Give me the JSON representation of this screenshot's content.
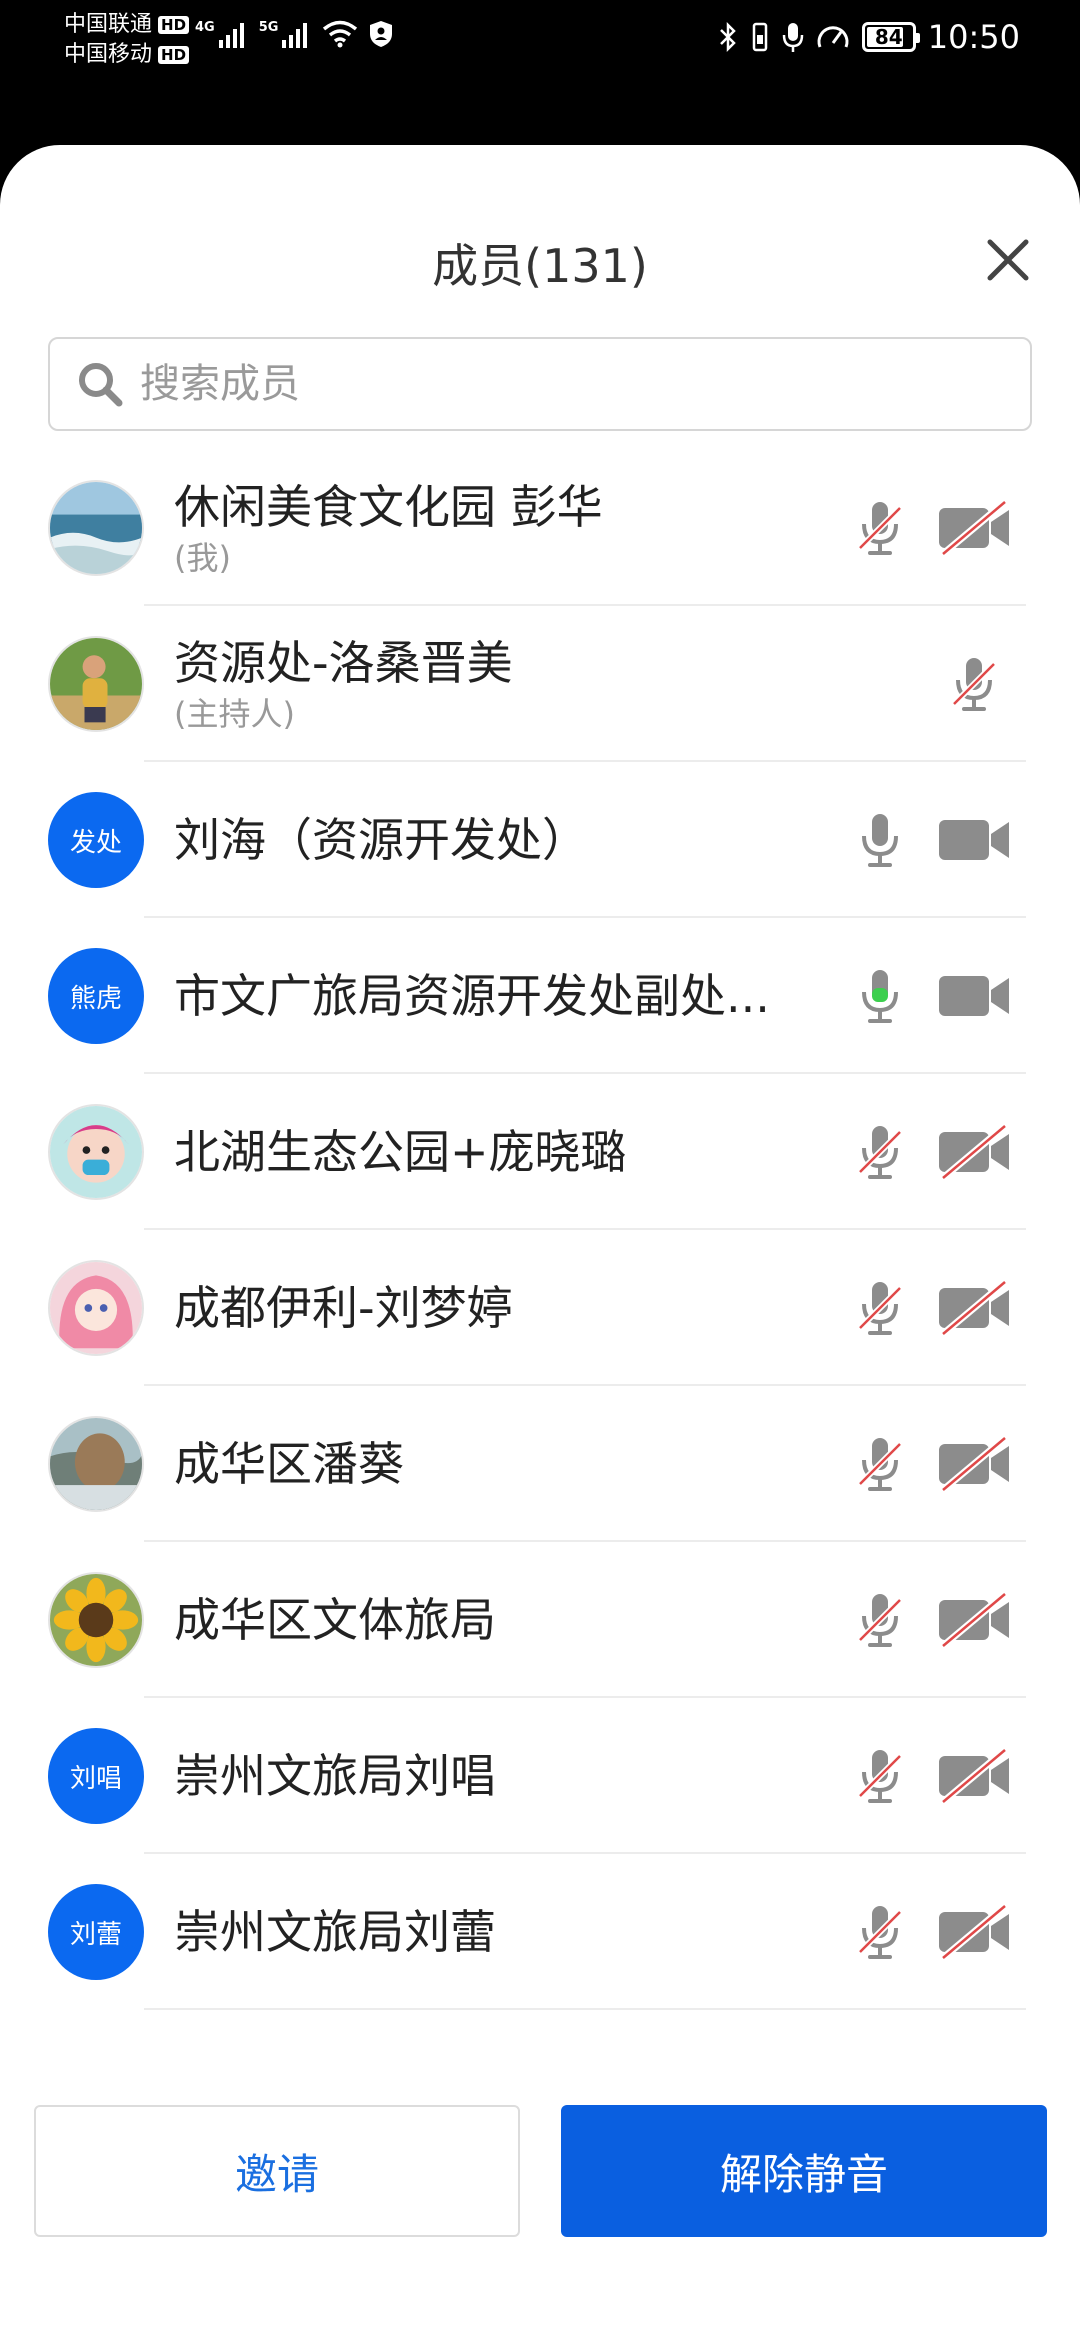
{
  "status_bar": {
    "carrier_1": "中国联通",
    "carrier_2": "中国移动",
    "hd_label": "HD",
    "net_1": "4G",
    "net_2": "5G",
    "battery_level": "84",
    "battery_fraction": 0.84,
    "time": "10:50"
  },
  "sheet": {
    "title": "成员(131)",
    "close_icon": "close-icon"
  },
  "search": {
    "placeholder": "搜索成员",
    "value": ""
  },
  "members": [
    {
      "name": "休闲美食文化园 彭华",
      "role": "(我)",
      "avatar": "photo-sea",
      "mic": "muted",
      "camera": "off"
    },
    {
      "name": "资源处-洛桑晋美",
      "role": "(主持人)",
      "avatar": "photo-person",
      "mic": "muted",
      "camera": "none"
    },
    {
      "name": "刘海（资源开发处）",
      "role": "",
      "avatar_text": "发处",
      "mic": "on",
      "camera": "on"
    },
    {
      "name": "市文广旅局资源开发处副处...",
      "role": "",
      "avatar_text": "熊虎",
      "mic": "speaking",
      "camera": "on"
    },
    {
      "name": "北湖生态公园+庞晓璐",
      "role": "",
      "avatar": "photo-cartoon",
      "mic": "muted",
      "camera": "off"
    },
    {
      "name": "成都伊利-刘梦婷",
      "role": "",
      "avatar": "photo-anime",
      "mic": "muted",
      "camera": "off"
    },
    {
      "name": "成华区潘葵",
      "role": "",
      "avatar": "photo-landscape",
      "mic": "muted",
      "camera": "off"
    },
    {
      "name": "成华区文体旅局",
      "role": "",
      "avatar": "photo-sunflower",
      "mic": "muted",
      "camera": "off"
    },
    {
      "name": "崇州文旅局刘唱",
      "role": "",
      "avatar_text": "刘唱",
      "mic": "muted",
      "camera": "off"
    },
    {
      "name": "崇州文旅局刘蕾",
      "role": "",
      "avatar_text": "刘蕾",
      "mic": "muted",
      "camera": "off"
    }
  ],
  "buttons": {
    "invite": "邀请",
    "unmute_all": "解除静音"
  },
  "colors": {
    "accent": "#0a5fe0",
    "avatar_blue": "#0b69f0",
    "muted_red": "#e04848",
    "speaking_green": "#3ccf4e",
    "icon_gray": "#8c8c8c"
  }
}
